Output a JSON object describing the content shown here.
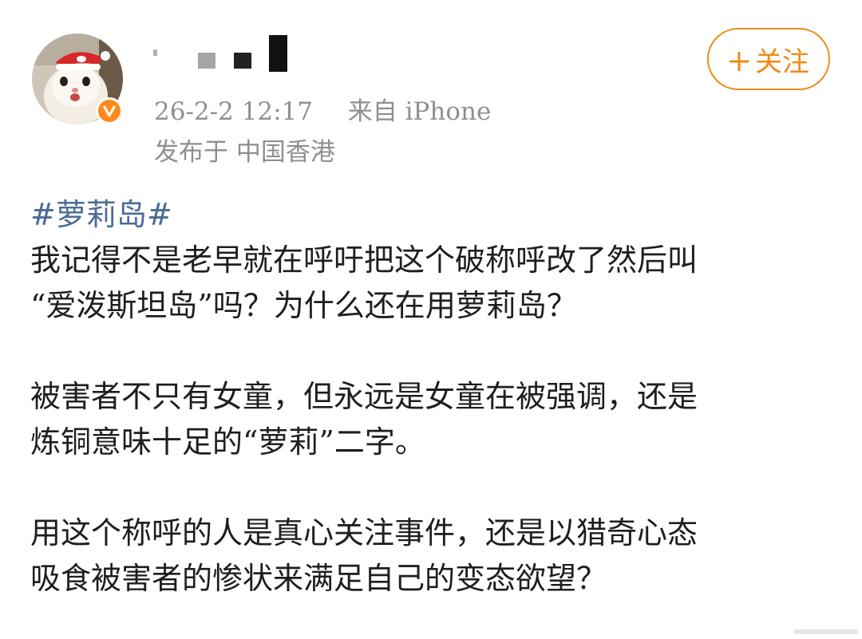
{
  "post": {
    "author": {
      "verified": true,
      "badge_color": "#ff8a1a"
    },
    "timestamp": "26-2-2 12:17",
    "source": "来自 iPhone",
    "location": "发布于 中国香港",
    "follow_label": "关注",
    "accent_color": "#f08a17",
    "hashtag": "#萝莉岛#",
    "paragraphs": [
      [
        "我记得不是老早就在呼吁把这个破称呼改了然后叫",
        "“爱泼斯坦岛”吗？为什么还在用萝莉岛？"
      ],
      [
        "被害者不只有女童，但永远是女童在被强调，还是",
        "炼铜意味十足的“萝莉”二字。"
      ],
      [
        "用这个称呼的人是真心关注事件，还是以猎奇心态",
        "吸食被害者的惨状来满足自己的变态欲望？"
      ]
    ]
  }
}
